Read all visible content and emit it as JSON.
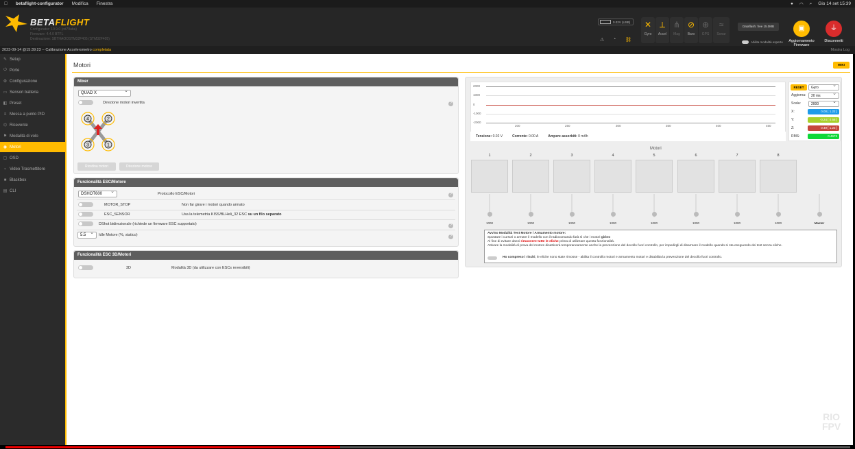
{
  "mac_menu": {
    "app": "betaflight-configurator",
    "items": [
      "Modifica",
      "Finestra"
    ],
    "clock": "Gio 14 set  15:39"
  },
  "header": {
    "brand_left": "BETA",
    "brand_right": "FLIGHT",
    "version_lines": [
      "Configurator: 10.9.0 (cd79aba)",
      "Firmware: 4.4.0 BTFL",
      "Destinazione: SBTHAOOSTM32F405 (STM32F405)"
    ],
    "battery_text": "0.02V (USB)",
    "sensors": [
      {
        "label": "Gyro",
        "icon": "gyro-icon",
        "active": true
      },
      {
        "label": "Accel",
        "icon": "accel-icon",
        "active": true
      },
      {
        "label": "Mag",
        "icon": "mag-icon",
        "active": false
      },
      {
        "label": "Baro",
        "icon": "baro-icon",
        "active": true
      },
      {
        "label": "GPS",
        "icon": "gps-icon",
        "active": false
      },
      {
        "label": "Sonar",
        "icon": "sonar-icon",
        "active": false
      }
    ],
    "dataflash": "Dataflash: free 15.0MB",
    "expert_mode": "Abilita modalità esperto",
    "firmware_update": "Aggiornamento Firmware",
    "disconnect": "Disconnetti",
    "brand_color": "#ffbb00",
    "disconnect_color": "#d92c2c"
  },
  "logbar": {
    "text": "2023-09-14 @15:39:23 -- Calibrazione Accelerometro",
    "status": "completata",
    "show_log": "Mostra Log"
  },
  "sidebar": {
    "items": [
      {
        "label": "Setup",
        "icon": "wrench-icon"
      },
      {
        "label": "Porte",
        "icon": "plug-icon"
      },
      {
        "label": "Configurazione",
        "icon": "gear-icon"
      },
      {
        "label": "Sensori batteria",
        "icon": "battery-icon"
      },
      {
        "label": "Preset",
        "icon": "preset-icon"
      },
      {
        "label": "Messa a punto PID",
        "icon": "tune-icon"
      },
      {
        "label": "Ricevente",
        "icon": "receiver-icon"
      },
      {
        "label": "Modalità di volo",
        "icon": "flag-icon"
      },
      {
        "label": "Motori",
        "icon": "motor-icon",
        "active": true
      },
      {
        "label": "OSD",
        "icon": "osd-icon"
      },
      {
        "label": "Video Trasmettitore",
        "icon": "vtx-icon"
      },
      {
        "label": "Blackbox",
        "icon": "blackbox-icon"
      },
      {
        "label": "CLI",
        "icon": "cli-icon"
      }
    ]
  },
  "page": {
    "title": "Motori",
    "wiki": "WIKI"
  },
  "mixer": {
    "title": "Mixer",
    "type": "QUAD X",
    "reverse_label": "Direzione motori invertita",
    "motor_labels": [
      "4",
      "2",
      "3",
      "1"
    ],
    "btn_reorder": "Riordina motori",
    "btn_direction": "Direzione motore"
  },
  "esc": {
    "title": "Funzionalità ESC/Motore",
    "protocol": "DSHOT600",
    "protocol_label": "Protocollo ESC/Motori",
    "motor_stop": "MOTOR_STOP",
    "motor_stop_desc": "Non far girare i motori quando armato",
    "esc_sensor": "ESC_SENSOR",
    "esc_sensor_desc": "Usa la telemetria KISS/BLHeli_32 ESC",
    "esc_sensor_desc_bold": "su un filo separato",
    "bidir": "DShot bidirezionale (richiede un firmware ESC supportato)",
    "idle_value": "5.5",
    "idle_label": "Idle Motore (%, statico)"
  },
  "esc3d": {
    "title": "Funzionalità ESC 3D/Motori",
    "label": "3D",
    "desc": "Modalità 3D (da utilizzare con ESCs reversibili)"
  },
  "graph": {
    "yticks": [
      "2000",
      "1000",
      "0",
      "-1000",
      "-2000"
    ],
    "xticks": [
      "200",
      "250",
      "300",
      "350",
      "400",
      "450"
    ],
    "tension_label": "Tensione:",
    "tension": "0.02 V",
    "current_label": "Corrente:",
    "current": "0.00 A",
    "absorbed_label": "Ampere assorbiti:",
    "absorbed": "0 mAh"
  },
  "graph_ctrl": {
    "reset": "RESET",
    "source": "Gyro",
    "refresh_label": "Aggiorna:",
    "refresh": "20 ms",
    "scale_label": "Scala:",
    "scale": "2000",
    "x_label": "X:",
    "x_value": "0.00 [ 1.22 ]",
    "y_label": "Y:",
    "y_value": "-0.24 [ 0.58 ]",
    "z_label": "Z:",
    "z_value": "0.49 [ 1.22 ]",
    "rms_label": "RMS:",
    "rms_value": "0.4673",
    "x_color": "#1e9be9",
    "y_color": "#a8d02a",
    "z_color": "#c6463c",
    "rms_color": "#0ed838"
  },
  "motors": {
    "title": "Motori",
    "numbers": [
      "1",
      "2",
      "3",
      "4",
      "5",
      "6",
      "7",
      "8"
    ],
    "values": [
      "1000",
      "1000",
      "1000",
      "1000",
      "1000",
      "1000",
      "1000",
      "1000"
    ],
    "master": "Master"
  },
  "warning": {
    "title": "Avviso Modalità Test Motore / Armamento motore:",
    "line1": "Spostare i cursori o armare il modello con il radiocomando farà sì che i motori",
    "line1_bold": "girino",
    "line2_pre": "Al fine di evitare danni",
    "line2_red": "rimuovere tutte le eliche",
    "line2_post": "prima di utilizzare questa funzionalità.",
    "line3": "Attivare la modalità di prova del motore disattiverà temporaneamente anche la prevenzione del decollo fuori controllo, per impedirgli di disarmare il modello quando si sta eseguendo dei test senza eliche.",
    "risk_bold": "Ho compreso i rischi",
    "risk_rest": ", le eliche sono state rimosse - abilita il controllo motori e armamento motori e disabilita la prevenzione del decollo fuori controllo."
  },
  "video": {
    "progress": 0.396,
    "watermark_top": "RIO",
    "watermark_bottom": "FPV"
  }
}
